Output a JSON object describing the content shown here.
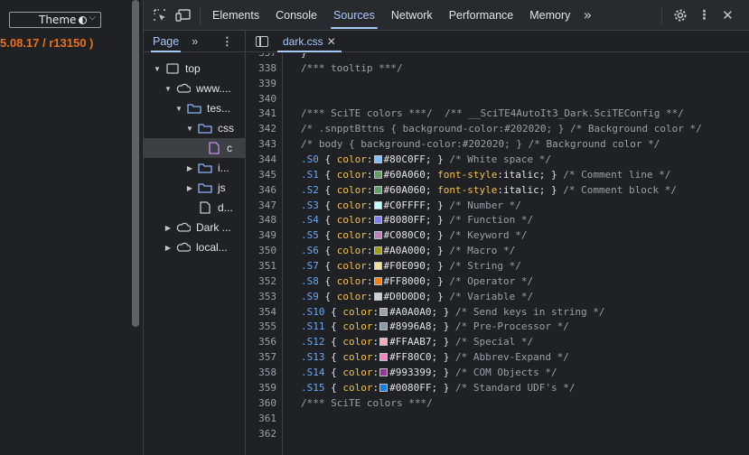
{
  "webpage": {
    "theme_label": "Theme",
    "version_text": "5.08.17 / r13150 )"
  },
  "toolbar": {
    "tabs": [
      "Elements",
      "Console",
      "Sources",
      "Network",
      "Performance",
      "Memory"
    ],
    "active_tab": "Sources",
    "more_tabs_glyph": "»",
    "icons": [
      "inspect-element-icon",
      "device-toggle-icon",
      "settings-gear-icon",
      "more-options-icon",
      "close-icon"
    ]
  },
  "navigator": {
    "tab": "Page",
    "more_glyph": "»",
    "menu_glyph": "⋮",
    "tree": [
      {
        "label": "top",
        "icon": "frame-icon",
        "expanded": true
      },
      {
        "label": "www....",
        "icon": "cloud-icon",
        "expanded": true
      },
      {
        "label": "tes...",
        "icon": "folder-icon",
        "expanded": true
      },
      {
        "label": "css",
        "icon": "folder-icon",
        "expanded": true
      },
      {
        "label": "c",
        "icon": "css-file-icon",
        "selected": true
      },
      {
        "label": "i...",
        "icon": "folder-icon",
        "expanded": false
      },
      {
        "label": "js",
        "icon": "folder-icon",
        "expanded": false
      },
      {
        "label": "d...",
        "icon": "file-icon"
      },
      {
        "label": "Dark ...",
        "icon": "cloud-icon",
        "expanded": false
      },
      {
        "label": "local...",
        "icon": "cloud-icon",
        "expanded": false
      }
    ]
  },
  "editor": {
    "file_tab": "dark.css",
    "lines": [
      {
        "n": "337",
        "parts": [
          {
            "t": "}",
            "c": ""
          }
        ]
      },
      {
        "n": "338",
        "parts": [
          {
            "t": "/*** tooltip ***/",
            "c": "cmt"
          }
        ]
      },
      {
        "n": "339",
        "parts": []
      },
      {
        "n": "340",
        "parts": []
      },
      {
        "n": "341",
        "parts": [
          {
            "t": "/*** SciTE colors ***/  /** __SciTE4AutoIt3_Dark.SciTEConfig **/",
            "c": "cmt"
          }
        ]
      },
      {
        "n": "342",
        "parts": [
          {
            "t": "/* .snpptBttns { background-color:#202020; } /* Background color */",
            "c": "cmt"
          }
        ]
      },
      {
        "n": "343",
        "parts": [
          {
            "t": "/* body { background-color:#202020; } /* Background color */",
            "c": "cmt"
          }
        ]
      },
      {
        "n": "344",
        "sel": ".S0",
        "color": "#80C0FF",
        "extra": "",
        "comment": "/* White space */"
      },
      {
        "n": "345",
        "sel": ".S1",
        "color": "#60A060",
        "extra": "italic",
        "comment": "/* Comment line */"
      },
      {
        "n": "346",
        "sel": ".S2",
        "color": "#60A060",
        "extra": "italic",
        "comment": "/* Comment block */"
      },
      {
        "n": "347",
        "sel": ".S3",
        "color": "#C0FFFF",
        "extra": "",
        "comment": "/* Number */"
      },
      {
        "n": "348",
        "sel": ".S4",
        "color": "#8080FF",
        "extra": "",
        "comment": "/* Function */"
      },
      {
        "n": "349",
        "sel": ".S5",
        "color": "#C080C0",
        "extra": "",
        "comment": "/* Keyword */"
      },
      {
        "n": "350",
        "sel": ".S6",
        "color": "#A0A000",
        "extra": "",
        "comment": "/* Macro */"
      },
      {
        "n": "351",
        "sel": ".S7",
        "color": "#F0E090",
        "extra": "",
        "comment": "/* String */"
      },
      {
        "n": "352",
        "sel": ".S8",
        "color": "#FF8000",
        "extra": "",
        "comment": "/* Operator */"
      },
      {
        "n": "353",
        "sel": ".S9",
        "color": "#D0D0D0",
        "extra": "",
        "comment": "/* Variable */"
      },
      {
        "n": "354",
        "sel": ".S10",
        "color": "#A0A0A0",
        "extra": "",
        "comment": "/* Send keys in string */"
      },
      {
        "n": "355",
        "sel": ".S11",
        "color": "#8996A8",
        "extra": "",
        "comment": "/* Pre-Processor */"
      },
      {
        "n": "356",
        "sel": ".S12",
        "color": "#FFAAB7",
        "extra": "",
        "comment": "/* Special */"
      },
      {
        "n": "357",
        "sel": ".S13",
        "color": "#FF80C0",
        "extra": "",
        "comment": "/* Abbrev-Expand */"
      },
      {
        "n": "358",
        "sel": ".S14",
        "color": "#993399",
        "extra": "",
        "comment": "/* COM Objects */"
      },
      {
        "n": "359",
        "sel": ".S15",
        "color": "#0080FF",
        "extra": "",
        "comment": "/* Standard UDF's */"
      },
      {
        "n": "360",
        "parts": [
          {
            "t": "/*** SciTE colors ***/",
            "c": "cmt"
          }
        ]
      },
      {
        "n": "361",
        "parts": []
      },
      {
        "n": "362",
        "parts": []
      }
    ]
  }
}
